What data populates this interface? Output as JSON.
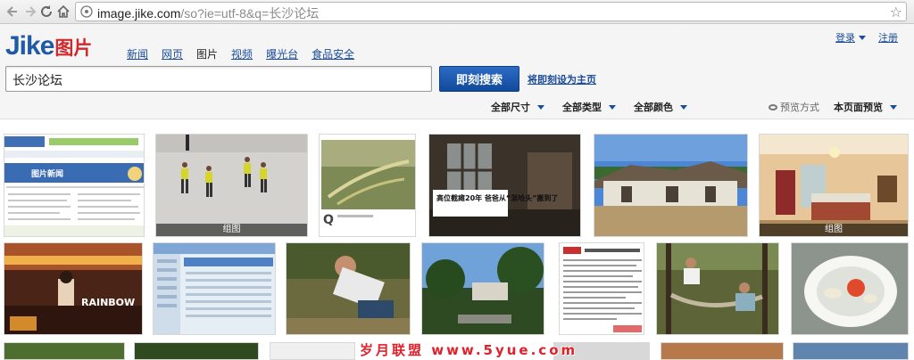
{
  "browser": {
    "url_host": "image.jike.com",
    "url_path": "/so?ie=utf-8&q=长沙论坛"
  },
  "header": {
    "logo_main": "Jike",
    "logo_sub": "图片",
    "nav": [
      {
        "label": "新闻",
        "active": false
      },
      {
        "label": "网页",
        "active": false
      },
      {
        "label": "图片",
        "active": true
      },
      {
        "label": "视频",
        "active": false
      },
      {
        "label": "曝光台",
        "active": false
      },
      {
        "label": "食品安全",
        "active": false
      }
    ],
    "login_label": "登录",
    "register_label": "注册"
  },
  "search": {
    "query": "长沙论坛",
    "button_label": "即刻搜索",
    "sethome_label": "将即刻设为主页"
  },
  "filters": {
    "size": "全部尺寸",
    "type": "全部类型",
    "color": "全部颜色",
    "preview_mode": "预览方式",
    "preview_value": "本页面预览"
  },
  "thumbnails": {
    "group_caption": "组图",
    "row1": [
      {
        "name": "webpage-screenshot",
        "text": "图片新闻"
      },
      {
        "name": "sand-football",
        "caption": "组图"
      },
      {
        "name": "grass-macro",
        "text": "Q"
      },
      {
        "name": "old-house-interior",
        "text": "高位截瘫20年 爸爸从“混哈头”搬到了"
      },
      {
        "name": "rural-courtyard"
      },
      {
        "name": "hotel-room",
        "caption": "组图"
      }
    ],
    "row2": [
      {
        "name": "stage-performance",
        "text": "RAINBOW"
      },
      {
        "name": "software-window"
      },
      {
        "name": "man-lying-ground"
      },
      {
        "name": "campus-trees"
      },
      {
        "name": "news-document"
      },
      {
        "name": "hammock-forest"
      },
      {
        "name": "food-bowl"
      }
    ]
  },
  "watermark": "岁月联盟 www.5yue.com",
  "colors": {
    "link": "#1a4c9c",
    "button": "#114a9c",
    "logo_blue": "#1f5aa6",
    "logo_red": "#d0282b",
    "watermark": "#e0202a"
  }
}
